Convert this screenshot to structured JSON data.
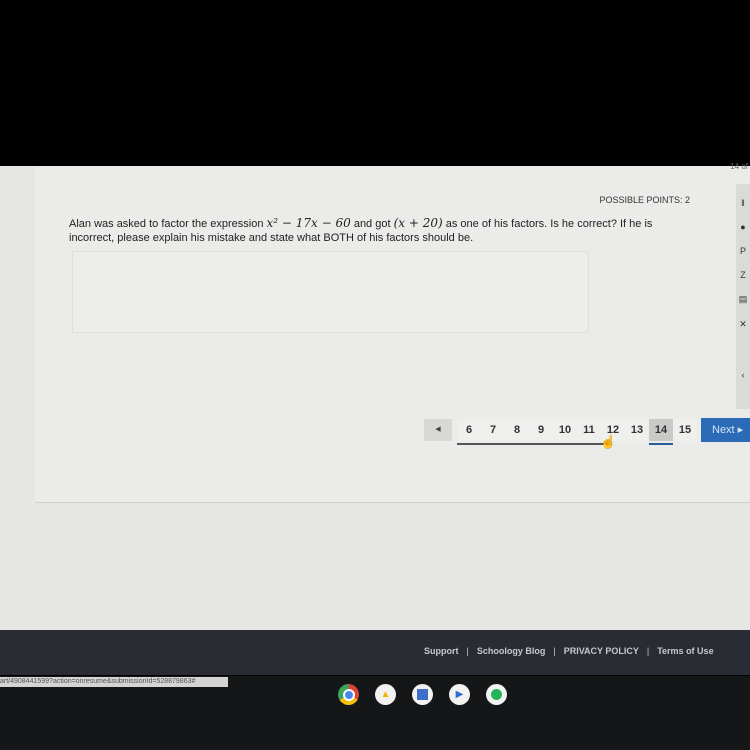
{
  "header": {
    "page_indicator": "14 of"
  },
  "question": {
    "possible_points": "POSSIBLE POINTS: 2",
    "text_part1": "Alan was asked to factor the expression ",
    "math1": "x² − 17x − 60",
    "text_part2": " and got ",
    "math2": "(x + 20)",
    "text_part3": " as one of his factors.  Is he correct?  If he is incorrect, please explain his mistake and state what BOTH of his factors should be.",
    "answer_value": ""
  },
  "side_tools": [
    "‖",
    "●",
    "P",
    "Z",
    "▤",
    "✕",
    "‹"
  ],
  "pagination": {
    "prev_label": "◀",
    "pages": [
      "6",
      "7",
      "8",
      "9",
      "10",
      "11",
      "12",
      "13",
      "14",
      "15"
    ],
    "active_page": "14",
    "next_label": "Next ▸"
  },
  "footer": {
    "links": [
      "Support",
      "Schoology Blog",
      "PRIVACY POLICY",
      "Terms of Use"
    ]
  },
  "status_url": "art/4908441599?action=onresume&submissionId=528879863#",
  "shelf": {
    "apps": [
      {
        "name": "chrome",
        "color": "#d9453b"
      },
      {
        "name": "drive",
        "color": "#f2f2f2"
      },
      {
        "name": "calendar-app",
        "color": "#3d6ec9"
      },
      {
        "name": "play-app",
        "color": "#2c6fd1"
      },
      {
        "name": "whatsapp",
        "color": "#25b35a"
      }
    ]
  }
}
